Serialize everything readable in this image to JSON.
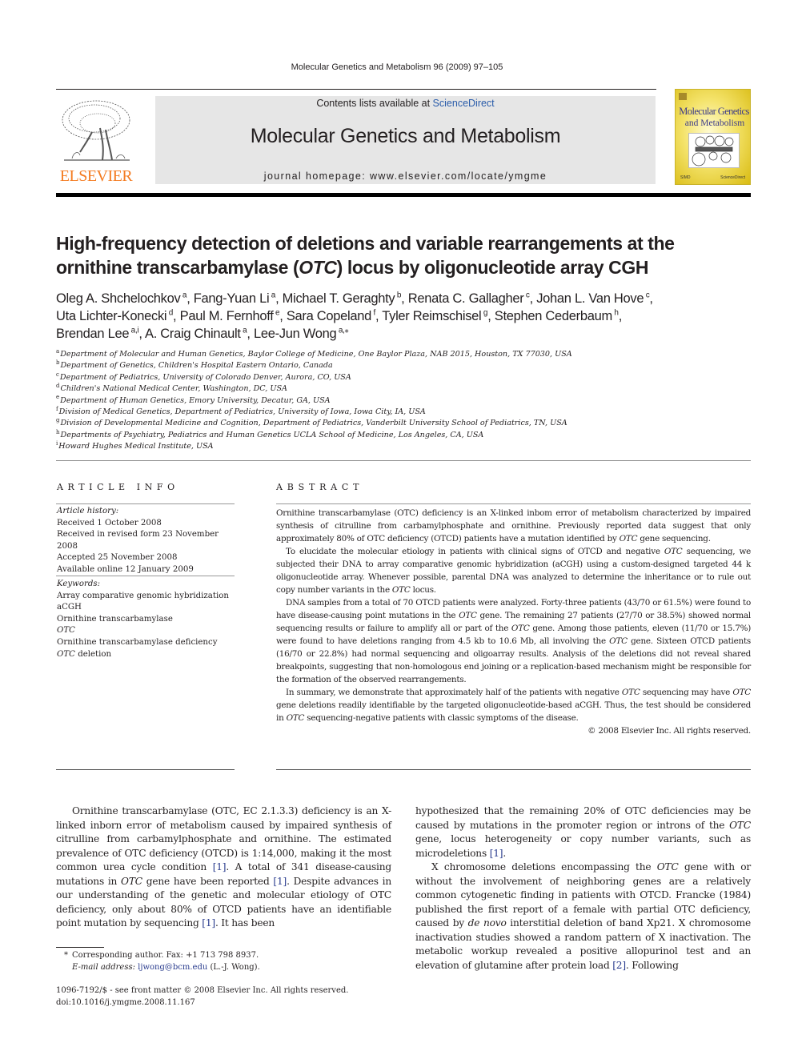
{
  "running_head": "Molecular Genetics and Metabolism 96 (2009) 97–105",
  "publisher_logo": {
    "icon": "elsevier-tree-icon",
    "text": "ELSEVIER",
    "color": "#f47b20"
  },
  "banner": {
    "contents_prefix": "Contents lists available at ",
    "contents_link": "ScienceDirect",
    "journal_title": "Molecular Genetics and Metabolism",
    "homepage": "journal homepage: www.elsevier.com/locate/ymgme",
    "background": "#e6e6e6",
    "link_color": "#2a5caa"
  },
  "cover": {
    "title_line1": "Molecular Genetics",
    "title_line2": "and Metabolism",
    "footer_left": "SIMD",
    "footer_right": "ScienceDirect"
  },
  "article": {
    "title_part1": "High-frequency detection of deletions and variable rearrangements at the ornithine transcarbamylase (",
    "title_italic": "OTC",
    "title_part2": ") locus by oligonucleotide array CGH",
    "authors": [
      {
        "name": "Oleg A. Shchelochkov",
        "sup": "a"
      },
      {
        "name": "Fang-Yuan Li",
        "sup": "a"
      },
      {
        "name": "Michael T. Geraghty",
        "sup": "b"
      },
      {
        "name": "Renata C. Gallagher",
        "sup": "c"
      },
      {
        "name": "Johan L. Van Hove",
        "sup": "c"
      },
      {
        "name": "Uta Lichter-Konecki",
        "sup": "d"
      },
      {
        "name": "Paul M. Fernhoff",
        "sup": "e"
      },
      {
        "name": "Sara Copeland",
        "sup": "f"
      },
      {
        "name": "Tyler Reimschisel",
        "sup": "g"
      },
      {
        "name": "Stephen Cederbaum",
        "sup": "h"
      },
      {
        "name": "Brendan Lee",
        "sup": "a,i"
      },
      {
        "name": "A. Craig Chinault",
        "sup": "a"
      },
      {
        "name": "Lee-Jun Wong",
        "sup": "a,*"
      }
    ],
    "affiliations": [
      {
        "key": "a",
        "text": "Department of Molecular and Human Genetics, Baylor College of Medicine, One Baylor Plaza, NAB 2015, Houston, TX 77030, USA"
      },
      {
        "key": "b",
        "text": "Department of Genetics, Children's Hospital Eastern Ontario, Canada"
      },
      {
        "key": "c",
        "text": "Department of Pediatrics, University of Colorado Denver, Aurora, CO, USA"
      },
      {
        "key": "d",
        "text": "Children's National Medical Center, Washington, DC, USA"
      },
      {
        "key": "e",
        "text": "Department of Human Genetics, Emory University, Decatur, GA, USA"
      },
      {
        "key": "f",
        "text": "Division of Medical Genetics, Department of Pediatrics, University of Iowa, Iowa City, IA, USA"
      },
      {
        "key": "g",
        "text": "Division of Developmental Medicine and Cognition, Department of Pediatrics, Vanderbilt University School of Pediatrics, TN, USA"
      },
      {
        "key": "h",
        "text": "Departments of Psychiatry, Pediatrics and Human Genetics UCLA School of Medicine, Los Angeles, CA, USA"
      },
      {
        "key": "i",
        "text": "Howard Hughes Medical Institute, USA"
      }
    ]
  },
  "article_info": {
    "heading": "ARTICLE INFO",
    "history_label": "Article history:",
    "history": [
      "Received 1 October 2008",
      "Received in revised form 23 November 2008",
      "Accepted 25 November 2008",
      "Available online 12 January 2009"
    ],
    "keywords_label": "Keywords:",
    "keywords": [
      {
        "text": "Array comparative genomic hybridization",
        "italic": false
      },
      {
        "text": "aCGH",
        "italic": false
      },
      {
        "text": "Ornithine transcarbamylase",
        "italic": false
      },
      {
        "text": "OTC",
        "italic": true
      },
      {
        "text": "Ornithine transcarbamylase deficiency",
        "italic": false
      },
      {
        "text": "OTC|| deletion",
        "italic": "partial"
      }
    ]
  },
  "abstract": {
    "heading": "ABSTRACT",
    "paragraphs": [
      "Ornithine transcarbamylase (OTC) deficiency is an X-linked inbom error of metabolism characterized by impaired synthesis of citrulline from carbamylphosphate and ornithine. Previously reported data suggest that only approximately 80% of OTC deficiency (OTCD) patients have a mutation identified by *OTC* gene sequencing.",
      "To elucidate the molecular etiology in patients with clinical signs of OTCD and negative *OTC* sequencing, we subjected their DNA to array comparative genomic hybridization (aCGH) using a custom-designed targeted 44 k oligonucleotide array. Whenever possible, parental DNA was analyzed to determine the inheritance or to rule out copy number variants in the *OTC* locus.",
      "DNA samples from a total of 70 OTCD patients were analyzed. Forty-three patients (43/70 or 61.5%) were found to have disease-causing point mutations in the *OTC* gene. The remaining 27 patients (27/70 or 38.5%) showed normal sequencing results or failure to amplify all or part of the *OTC* gene. Among those patients, eleven (11/70 or 15.7%) were found to have deletions ranging from 4.5 kb to 10.6 Mb, all involving the *OTC* gene. Sixteen OTCD patients (16/70 or 22.8%) had normal sequencing and oligoarray results. Analysis of the deletions did not reveal shared breakpoints, suggesting that non-homologous end joining or a replication-based mechanism might be responsible for the formation of the observed rearrangements.",
      "In summary, we demonstrate that approximately half of the patients with negative *OTC* sequencing may have *OTC* gene deletions readily identifiable by the targeted oligonucleotide-based aCGH. Thus, the test should be considered in *OTC* sequencing-negative patients with classic symptoms of the disease."
    ],
    "copyright": "© 2008 Elsevier Inc. All rights reserved."
  },
  "body": {
    "left_column": [
      "Ornithine transcarbamylase (OTC, EC 2.1.3.3) deficiency is an X-linked inborn error of metabolism caused by impaired synthesis of citrulline from carbamylphosphate and ornithine. The estimated prevalence of OTC deficiency (OTCD) is 1:14,000, making it the most common urea cycle condition [[1]]. A total of 341 disease-causing mutations in *OTC* gene have been reported [[1]]. Despite advances in our understanding of the genetic and molecular etiology of OTC deficiency, only about 80% of OTCD patients have an identifiable point mutation by sequencing [[1]]. It has been"
    ],
    "right_column": [
      "hypothesized that the remaining 20% of OTC deficiencies may be caused by mutations in the promoter region or introns of the *OTC* gene, locus heterogeneity or copy number variants, such as microdeletions [[1]].",
      "X chromosome deletions encompassing the *OTC* gene with or without the involvement of neighboring genes are a relatively common cytogenetic finding in patients with OTCD. Francke (1984) published the first report of a female with partial OTC deficiency, caused by *de novo* interstitial deletion of band Xp21. X chromosome inactivation studies showed a random pattern of X inactivation. The metabolic workup revealed a positive allopurinol test and an elevation of glutamine after protein load [[2]]. Following"
    ],
    "ref_color": "#2a3c8e"
  },
  "footnote": {
    "star": "*",
    "corresponding": "Corresponding author. Fax: +1 713 798 8937.",
    "email_label": "E-mail address:",
    "email": "ljwong@bcm.edu",
    "email_suffix": "(L.-J. Wong)."
  },
  "imprint": {
    "issn_line": "1096-7192/$ - see front matter © 2008 Elsevier Inc. All rights reserved.",
    "doi": "doi:10.1016/j.ymgme.2008.11.167"
  }
}
